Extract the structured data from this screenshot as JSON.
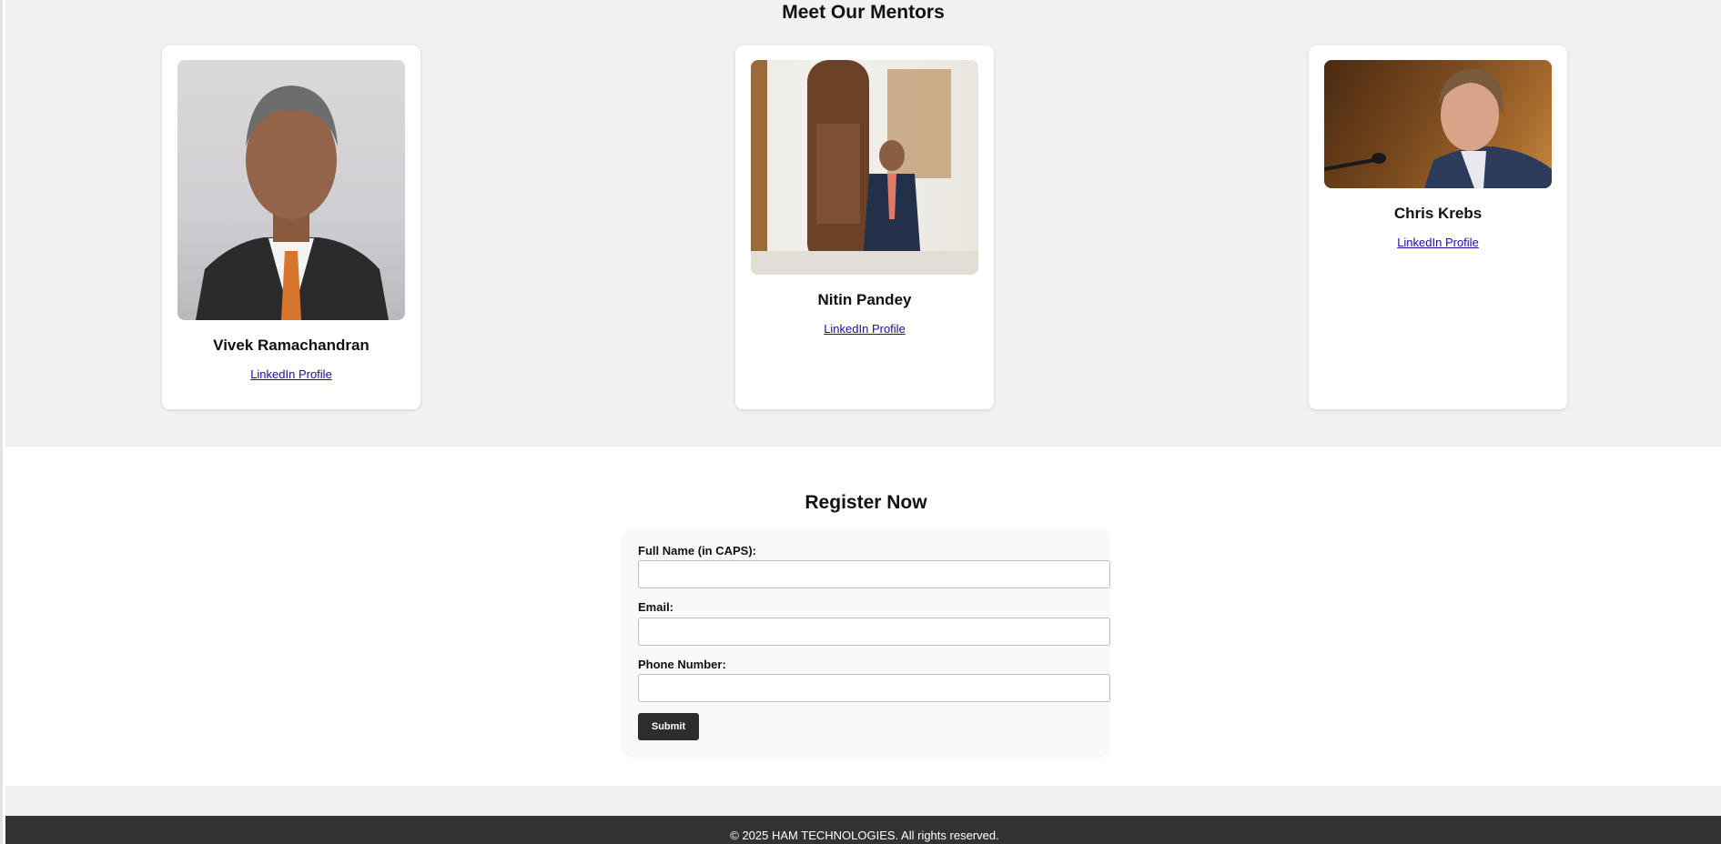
{
  "mentors_section": {
    "title": "Meet Our Mentors",
    "mentors": [
      {
        "name": "Vivek Ramachandran",
        "link_label": "LinkedIn Profile"
      },
      {
        "name": "Nitin Pandey",
        "link_label": "LinkedIn Profile"
      },
      {
        "name": "Chris Krebs",
        "link_label": "LinkedIn Profile"
      }
    ]
  },
  "register_section": {
    "title": "Register Now",
    "fields": [
      {
        "label": "Full Name (in CAPS):",
        "value": ""
      },
      {
        "label": "Email:",
        "value": ""
      },
      {
        "label": "Phone Number:",
        "value": ""
      }
    ],
    "submit_label": "Submit"
  },
  "footer": {
    "text": "© 2025 HAM TECHNOLOGIES. All rights reserved."
  },
  "colors": {
    "section_bg": "#f1f1f1",
    "card_bg": "#ffffff",
    "link": "#1a0dab",
    "button_bg": "#2d2d2d",
    "footer_bg": "#333333"
  }
}
